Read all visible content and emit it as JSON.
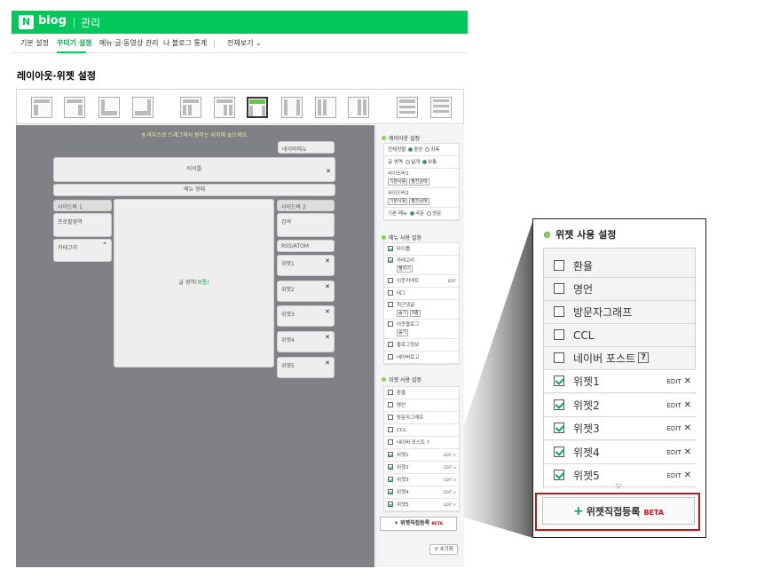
{
  "header": {
    "logo": "N",
    "brand": "blog",
    "manage": "관리"
  },
  "nav": {
    "items": [
      {
        "label": "기본 설정"
      },
      {
        "label": "꾸미기 설정"
      },
      {
        "label": "메뉴·글·동영상 관리"
      },
      {
        "label": "나 블로그 통계"
      },
      {
        "label": "전체보기"
      }
    ]
  },
  "page_title": "레이아웃·위젯 설정",
  "canvas": {
    "hint": "마우스로 드래그해서 원하는 위치에 놓으세요.",
    "top_menu": "네이버메뉴",
    "title": "타이틀",
    "menu": "메뉴 형태",
    "sidebar1": "사이드바 1",
    "sidebar2": "사이드바 2",
    "profile": "프로필영역",
    "category": "카테고리",
    "post": "글 영역",
    "post_suffix": "(보통)",
    "search": "검색",
    "rss": "RSS/ATOM",
    "widgets": [
      "위젯1",
      "위젯2",
      "위젯3",
      "위젯4",
      "위젯5"
    ]
  },
  "side": {
    "layout_header": "레이아웃 설정",
    "align_label": "전체정렬",
    "align_opts": [
      "중앙",
      "좌측"
    ],
    "width_label": "글 영역",
    "width_opts": [
      "넓게",
      "보통"
    ],
    "sb1_label": "사이드바1",
    "sb2_label": "사이드바2",
    "sb_sel1": "기본사용",
    "sb_sel2": "펼친상태",
    "menu_label": "기본 메뉴",
    "menu_opts": [
      "국문",
      "영문"
    ],
    "menu_header": "메뉴 사용 설정",
    "menu_items": [
      "타이틀",
      "카테고리",
      "이웃커넥트",
      "태그",
      "최근댓글",
      "이웃블로그",
      "블로그정보",
      "네이버로고"
    ],
    "menu_sub": {
      "cat": "펼치기",
      "recent": "숨기",
      "recent2": "5줄",
      "neighbor": "숨기"
    },
    "edit": "EDIT",
    "widget_header": "위젯 사용 설정",
    "widget_items": [
      "환율",
      "명언",
      "방문자그래프",
      "CCL",
      "네이버 포스트 ?",
      "위젯1",
      "위젯2",
      "위젯3",
      "위젯4",
      "위젯5"
    ],
    "add_btn": "+ 위젯직접등록",
    "beta": "BETA",
    "reset": "초기화"
  },
  "zoom": {
    "title": "위젯 사용 설정",
    "items": [
      {
        "label": "환율",
        "checked": false
      },
      {
        "label": "명언",
        "checked": false
      },
      {
        "label": "방문자그래프",
        "checked": false
      },
      {
        "label": "CCL",
        "checked": false
      },
      {
        "label": "네이버 포스트",
        "checked": false,
        "help": "?"
      },
      {
        "label": "위젯1",
        "checked": true
      },
      {
        "label": "위젯2",
        "checked": true
      },
      {
        "label": "위젯3",
        "checked": true
      },
      {
        "label": "위젯4",
        "checked": true
      },
      {
        "label": "위젯5",
        "checked": true
      }
    ],
    "edit": "EDIT",
    "close": "✕",
    "add_label": "위젯직접등록",
    "beta": "BETA"
  },
  "colors": {
    "brand": "#03c75a",
    "highlight": "#c4121b"
  }
}
